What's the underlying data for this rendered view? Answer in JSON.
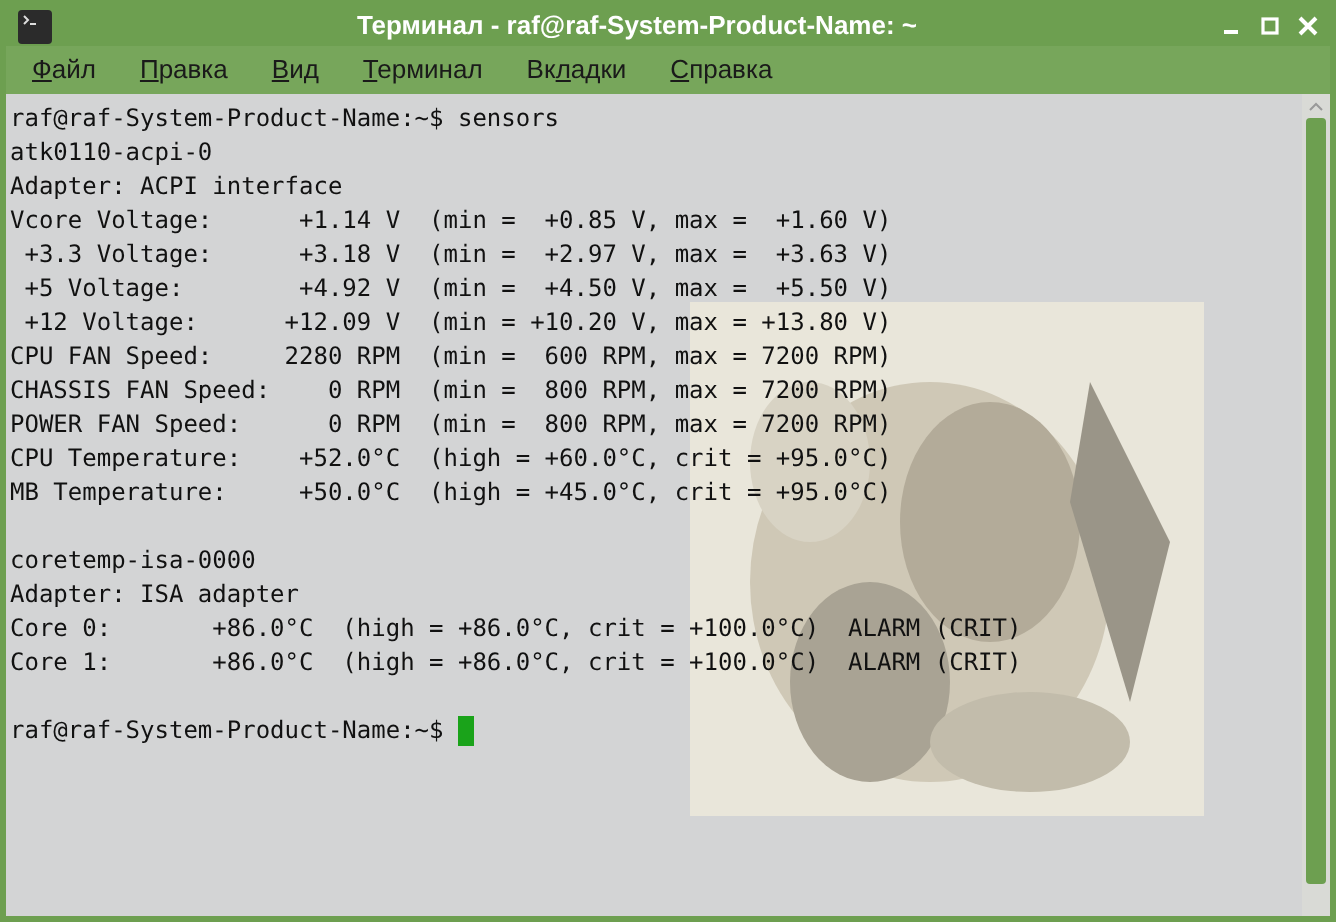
{
  "window": {
    "title": "Терминал - raf@raf-System-Product-Name: ~"
  },
  "menu": [
    {
      "key": "Ф",
      "rest": "айл"
    },
    {
      "key": "П",
      "rest": "равка"
    },
    {
      "key": "В",
      "rest": "ид"
    },
    {
      "key": "Т",
      "rest": "ерминал"
    },
    {
      "prefix": "Вк",
      "key": "л",
      "rest": "адки"
    },
    {
      "key": "С",
      "rest": "правка"
    }
  ],
  "terminal": {
    "blocks": [
      [
        "raf@raf-System-Product-Name:~$ sensors",
        "atk0110-acpi-0",
        "Adapter: ACPI interface",
        "Vcore Voltage:      +1.14 V  (min =  +0.85 V, max =  +1.60 V)",
        " +3.3 Voltage:      +3.18 V  (min =  +2.97 V, max =  +3.63 V)",
        " +5 Voltage:        +4.92 V  (min =  +4.50 V, max =  +5.50 V)",
        " +12 Voltage:      +12.09 V  (min = +10.20 V, max = +13.80 V)",
        "CPU FAN Speed:     2280 RPM  (min =  600 RPM, max = 7200 RPM)",
        "CHASSIS FAN Speed:    0 RPM  (min =  800 RPM, max = 7200 RPM)",
        "POWER FAN Speed:      0 RPM  (min =  800 RPM, max = 7200 RPM)",
        "CPU Temperature:    +52.0°C  (high = +60.0°C, crit = +95.0°C)",
        "MB Temperature:     +50.0°C  (high = +45.0°C, crit = +95.0°C)"
      ],
      [
        "coretemp-isa-0000",
        "Adapter: ISA adapter",
        "Core 0:       +86.0°C  (high = +86.0°C, crit = +100.0°C)  ALARM (CRIT)",
        "Core 1:       +86.0°C  (high = +86.0°C, crit = +100.0°C)  ALARM (CRIT)"
      ]
    ],
    "prompt": "raf@raf-System-Product-Name:~$ ",
    "cursor": true
  }
}
